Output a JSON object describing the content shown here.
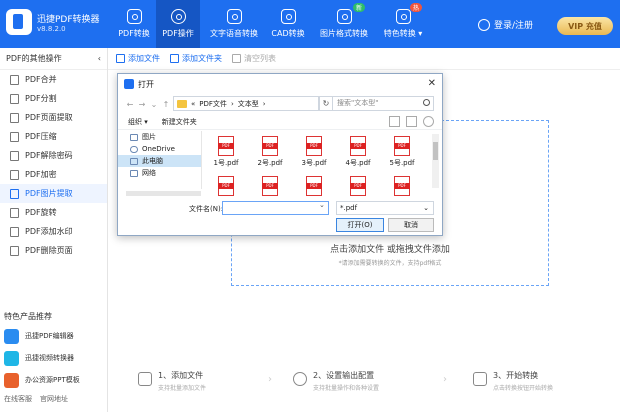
{
  "app": {
    "name": "迅捷PDF转换器",
    "version": "v8.8.2.0"
  },
  "nav": [
    {
      "label": "PDF转换",
      "active": false
    },
    {
      "label": "PDF操作",
      "active": true
    },
    {
      "label": "文字语音转换",
      "active": false
    },
    {
      "label": "CAD转换",
      "active": false
    },
    {
      "label": "图片格式转换",
      "active": false,
      "badge": "新"
    },
    {
      "label": "特色转换 ▾",
      "active": false,
      "badge": "热"
    }
  ],
  "user": {
    "login": "登录/注册",
    "vip": "VIP 充值"
  },
  "sidebar": {
    "header": "PDF的其他操作",
    "items": [
      "PDF合并",
      "PDF分割",
      "PDF页面提取",
      "PDF压缩",
      "PDF解除密码",
      "PDF加密",
      "PDF图片提取",
      "PDF旋转",
      "PDF添加水印",
      "PDF删除页面"
    ],
    "active_index": 6
  },
  "promo": {
    "title": "特色产品推荐",
    "items": [
      "迅捷PDF编辑器",
      "迅捷视频转换器",
      "办公资源PPT模板"
    ],
    "footer": [
      "在线客服",
      "官网地址"
    ]
  },
  "toolbar": {
    "add_file": "添加文件",
    "add_folder": "添加文件夹",
    "clear": "清空列表"
  },
  "dropzone": {
    "main": "点击添加文件 或拖拽文件添加",
    "sub": "*请添加需要转换的文件，支持pdf格式"
  },
  "steps": [
    {
      "title": "1、添加文件",
      "sub": "支持批量添加文件"
    },
    {
      "title": "2、设置输出配置",
      "sub": "支持批量操作和各种设置"
    },
    {
      "title": "3、开始转换",
      "sub": "点击转换按钮开始转换"
    }
  ],
  "dialog": {
    "title": "打开",
    "path": [
      "«",
      "PDF文件",
      "›",
      "文本型",
      "›"
    ],
    "search_placeholder": "搜索\"文本型\"",
    "organize": "组织 ▾",
    "new_folder": "新建文件夹",
    "nav_pane": [
      "图片",
      "OneDrive",
      "此电脑",
      "网络"
    ],
    "nav_selected": 2,
    "files_row1": [
      "1号.pdf",
      "2号.pdf",
      "3号.pdf",
      "4号.pdf",
      "5号.pdf"
    ],
    "files_row2": [
      "",
      "",
      "",
      "",
      ""
    ],
    "filename_label": "文件名(N):",
    "filename_value": "",
    "filetype": "*.pdf",
    "open_btn": "打开(O)",
    "cancel_btn": "取消"
  },
  "colors": {
    "primary": "#1e6ff0",
    "primary_dark": "#1556c4",
    "badge_new": "#2ebd6b",
    "badge_hot": "#f0553c"
  }
}
